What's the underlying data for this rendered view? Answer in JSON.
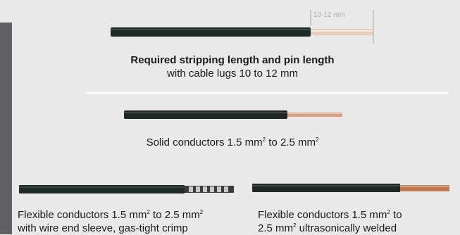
{
  "figure1": {
    "dim_label": "10-12 mm",
    "title": "Required stripping length and pin length",
    "subtitle": "with cable lugs 10 to 12 mm"
  },
  "figure2": {
    "caption_pre": "Solid conductors 1.5 mm",
    "caption_sup1": "2",
    "caption_mid": " to 2.5 mm",
    "caption_sup2": "2"
  },
  "figure3": {
    "line1_pre": "Flexible conductors 1.5 mm",
    "line1_sup1": "2",
    "line1_mid": " to 2.5 mm",
    "line1_sup2": "2",
    "line2": "with wire end sleeve, gas-tight crimp"
  },
  "figure4": {
    "line1": "Flexible conductors 1.5 mm",
    "line1_sup": "2",
    "line1_end": " to",
    "line2_pre": "2.5 mm",
    "line2_sup": "2",
    "line2_end": " ultrasonically welded"
  },
  "colors": {
    "cable_insulation": "#1f2a26",
    "copper": "#c98a66",
    "background": "#e9e9e9",
    "side_bar": "#5f6163"
  }
}
